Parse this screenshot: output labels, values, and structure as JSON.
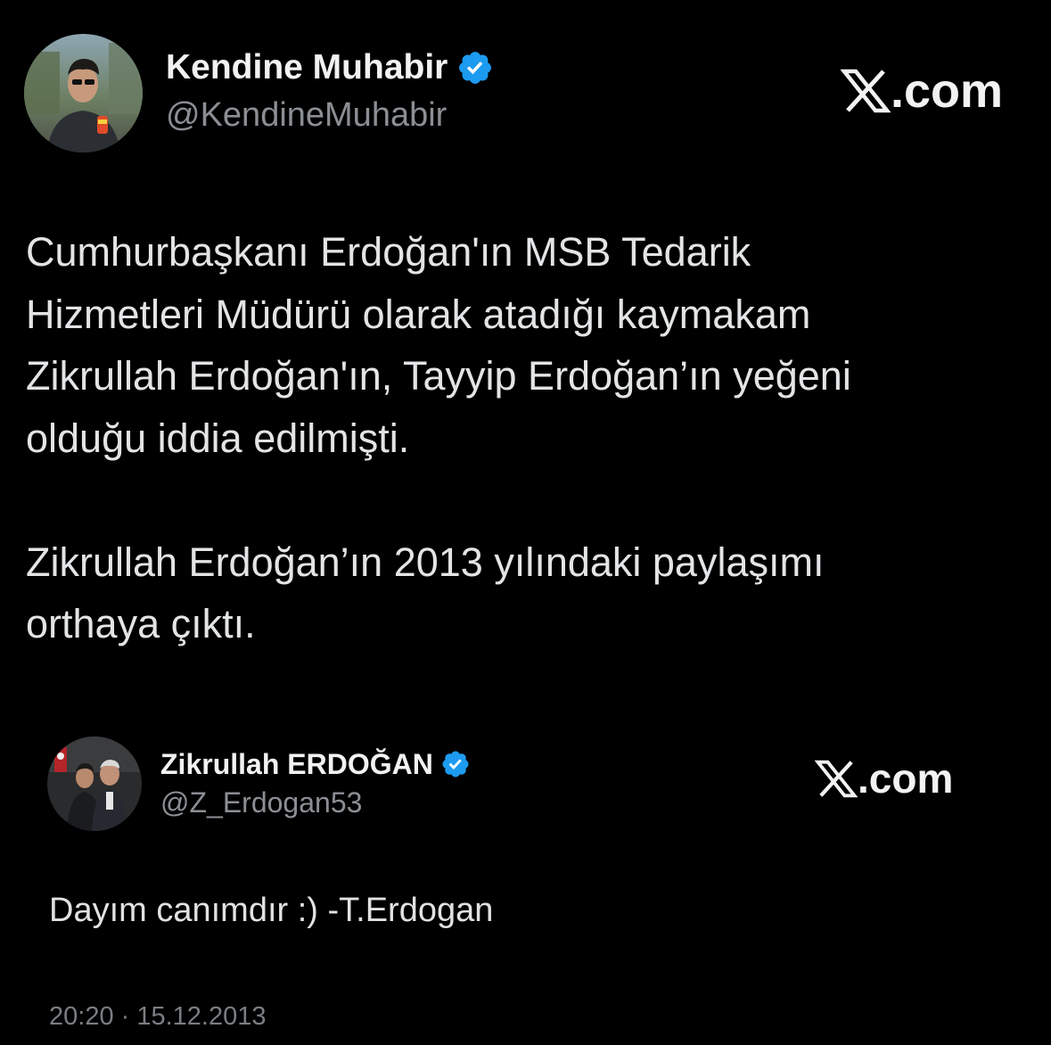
{
  "main_tweet": {
    "display_name": "Kendine Muhabir",
    "handle": "@KendineMuhabir",
    "verified": true,
    "watermark": "X.com",
    "text": "Cumhurbaşkanı Erdoğan'ın MSB Tedarik\nHizmetleri Müdürü olarak atadığı kaymakam\nZikrullah Erdoğan'ın, Tayyip Erdoğan’ın yeğeni\nolduğu iddia edilmişti.\n\nZikrullah Erdoğan’ın 2013 yılındaki paylaşımı\northaya çıktı.",
    "avatar_icon": "user-avatar-photo"
  },
  "quoted_tweet": {
    "display_name": "Zikrullah ERDOĞAN",
    "handle": "@Z_Erdogan53",
    "verified": true,
    "watermark": "X.com",
    "text": "Dayım canımdır :) -T.Erdogan",
    "timestamp": "20:20 · 15.12.2013",
    "avatar_icon": "user-avatar-photo"
  },
  "colors": {
    "background": "#000000",
    "verified_badge": "#1d9bf0",
    "text_primary": "#e7e9ea",
    "text_secondary": "#8b8f94"
  }
}
